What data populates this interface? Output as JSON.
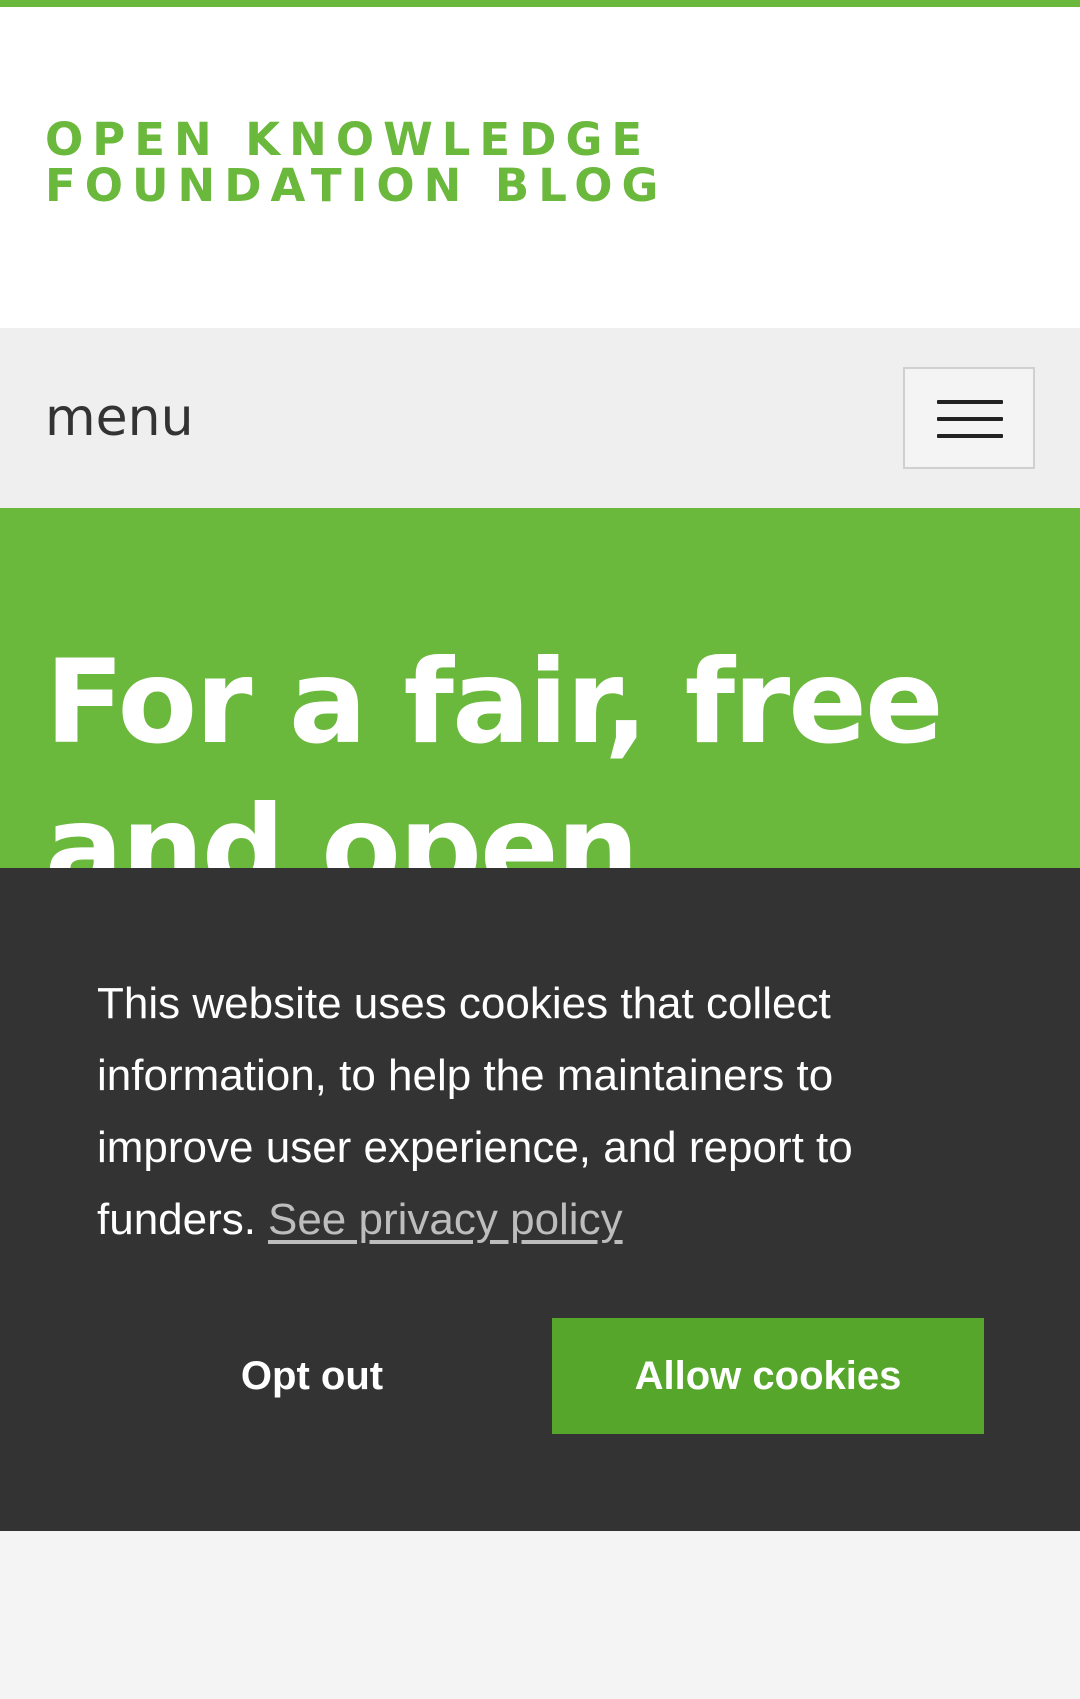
{
  "header": {
    "site_title": "OPEN KNOWLEDGE FOUNDATION BLOG"
  },
  "nav": {
    "menu_label": "menu",
    "toggle_icon": "hamburger-icon"
  },
  "hero": {
    "title": "For a fair, free and open future:"
  },
  "cookie_banner": {
    "message": "This website uses cookies that collect information, to help the maintainers to improve user experience, and report to funders.",
    "privacy_link": "See privacy policy",
    "opt_out_label": "Opt out",
    "allow_label": "Allow cookies"
  },
  "colors": {
    "brand_green": "#6ab83c",
    "allow_button": "#56a62c",
    "banner_bg": "#333333",
    "menu_bar_bg": "#efefef"
  }
}
